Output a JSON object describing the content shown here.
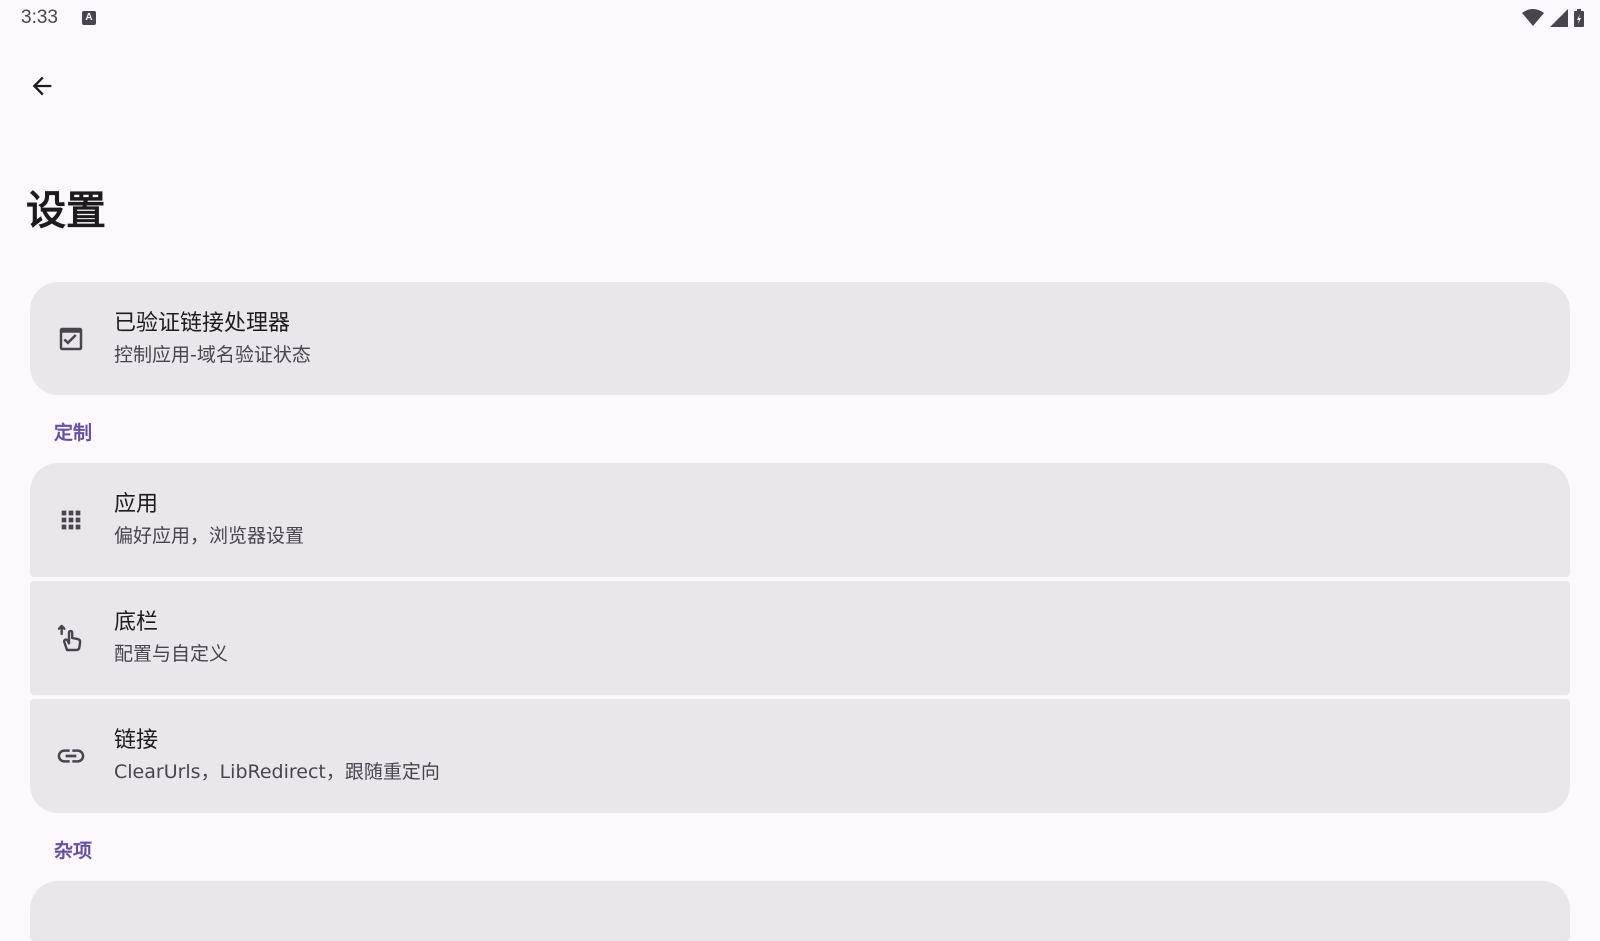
{
  "status_bar": {
    "time": "3:33",
    "keyboard_indicator": "A"
  },
  "header": {
    "back_icon": "arrow-back-icon",
    "title": "设置"
  },
  "items": {
    "verified_link_handlers": {
      "icon": "check-box-icon",
      "title": "已验证链接处理器",
      "subtitle": "控制应用-域名验证状态"
    },
    "section_customize": "定制",
    "apps": {
      "icon": "apps-grid-icon",
      "title": "应用",
      "subtitle": "偏好应用，浏览器设置"
    },
    "bottom_bar": {
      "icon": "swipe-gesture-icon",
      "title": "底栏",
      "subtitle": "配置与自定义"
    },
    "links": {
      "icon": "link-icon",
      "title": "链接",
      "subtitle": "ClearUrls，LibRedirect，跟随重定向"
    },
    "section_misc": "杂项"
  },
  "colors": {
    "background": "#fdf8fd",
    "card": "#ebe6ec",
    "accent": "#6750a4",
    "text_primary": "#1d1b20",
    "text_secondary": "#49454f"
  }
}
